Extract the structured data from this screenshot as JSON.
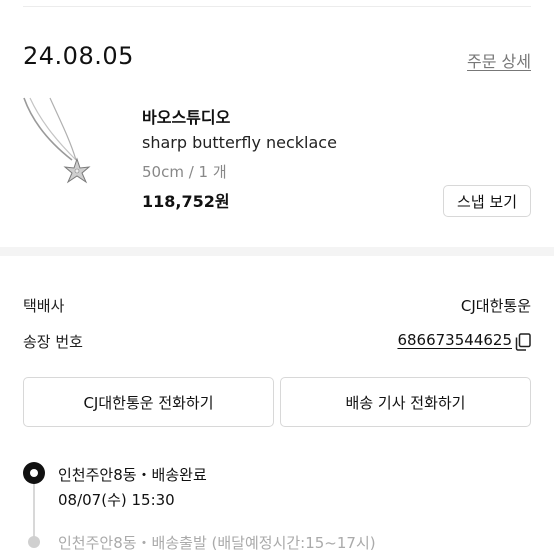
{
  "order": {
    "date": "24.08.05",
    "detail_link": "주문 상세"
  },
  "product": {
    "brand": "바오스튜디오",
    "name": "sharp butterfly necklace",
    "option": "50cm / 1 개",
    "price": "118,752원",
    "snap_button": "스냅 보기",
    "image_icon": "necklace-image"
  },
  "shipping": {
    "carrier_label": "택배사",
    "carrier_value": "CJ대한통운",
    "tracking_label": "송장 번호",
    "tracking_value": "686673544625",
    "copy_icon": "copy-icon",
    "call_carrier_button": "CJ대한통운 전화하기",
    "call_driver_button": "배송 기사 전화하기"
  },
  "timeline": [
    {
      "title": "인천주안8동・배송완료",
      "time": "08/07(수) 15:30",
      "status": "active"
    },
    {
      "title": "인천주안8동・배송출발 (배달예정시간:15~17시)",
      "status": "inactive"
    }
  ]
}
